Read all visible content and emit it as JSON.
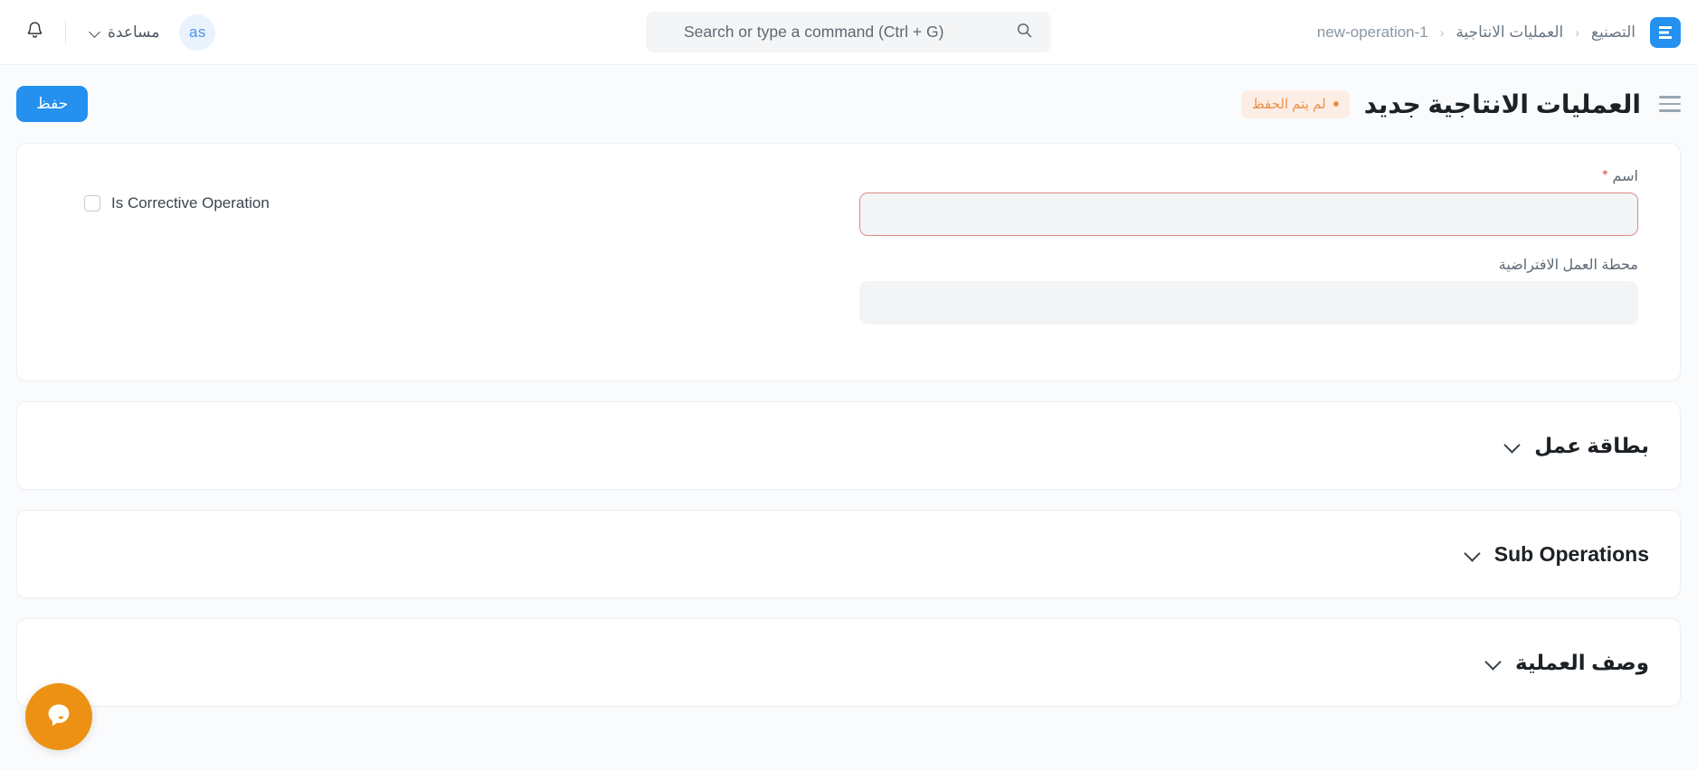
{
  "navbar": {
    "logo_icon": "erpnext-logo-icon",
    "breadcrumb": [
      {
        "label": "التصنيع"
      },
      {
        "label": "العمليات الانتاجية"
      },
      {
        "label": "new-operation-1"
      }
    ],
    "breadcrumb_separator": "‹",
    "search": {
      "placeholder": "Search or type a command (Ctrl + G)",
      "value": "",
      "icon": "search-icon"
    },
    "notifications_icon": "bell-icon",
    "help": {
      "label": "مساعدة",
      "icon": "chevron-down-icon"
    },
    "avatar": {
      "initials": "as"
    }
  },
  "page_head": {
    "menu_icon": "hamburger-icon",
    "title": "العمليات الانتاجية جديد",
    "status_badge": {
      "label": "لم يتم الحفظ",
      "dot_color": "#e8924b",
      "bg_color": "#fdeee5",
      "text_color": "#e8924b"
    },
    "save_label": "حفظ",
    "save_color": "#2490ef"
  },
  "form": {
    "name_field": {
      "label": "اسم",
      "required_marker": "*",
      "value": "",
      "placeholder": "",
      "invalid": true
    },
    "workstation_field": {
      "label": "محطة العمل الافتراضية",
      "value": "",
      "placeholder": ""
    },
    "corrective_checkbox": {
      "label": "Is Corrective Operation",
      "checked": false
    }
  },
  "sections": [
    {
      "title": "بطاقة عمل",
      "icon": "chevron-down-icon",
      "expanded": false
    },
    {
      "title": "Sub Operations",
      "icon": "chevron-down-icon",
      "expanded": false
    },
    {
      "title": "وصف العملية",
      "icon": "chevron-down-icon",
      "expanded": false
    }
  ],
  "chat_widget": {
    "icon": "chat-bubble-icon",
    "color": "#ed9114"
  }
}
